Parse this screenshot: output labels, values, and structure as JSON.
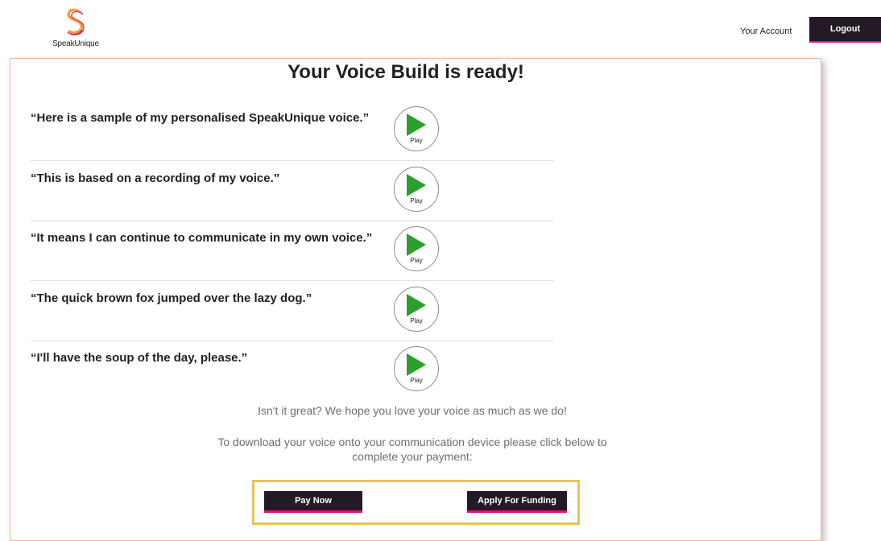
{
  "header": {
    "logo_text": "SpeakUnique",
    "account_link": "Your Account",
    "logout_label": "Logout"
  },
  "main": {
    "title": "Your Voice Build is ready!",
    "samples": [
      {
        "text": "“Here is a sample of my personalised SpeakUnique voice.”",
        "play_label": "Play"
      },
      {
        "text": "“This is based on a recording of my voice.”",
        "play_label": "Play"
      },
      {
        "text": "“It means I can continue to communicate in my own voice.”",
        "play_label": "Play"
      },
      {
        "text": "“The quick brown fox jumped over the lazy dog.”",
        "play_label": "Play"
      },
      {
        "text": "“I'll have the soup of the day, please.”",
        "play_label": "Play"
      }
    ],
    "message": "Isn't it great? We hope you love your voice as much as we do!",
    "download_line1": "To download your voice onto your communication device please click below to",
    "download_line2": "complete your payment:",
    "pay_now_label": "Pay Now",
    "apply_funding_label": "Apply For Funding"
  },
  "colors": {
    "button_bg": "#231a26",
    "accent_pink": "#e0107a",
    "play_green": "#2ca02c",
    "cta_border": "#e6c45a",
    "card_border": "#f2b8a6"
  },
  "icons": {
    "logo": "speakunique-s-logo-icon",
    "play": "play-triangle-icon"
  }
}
